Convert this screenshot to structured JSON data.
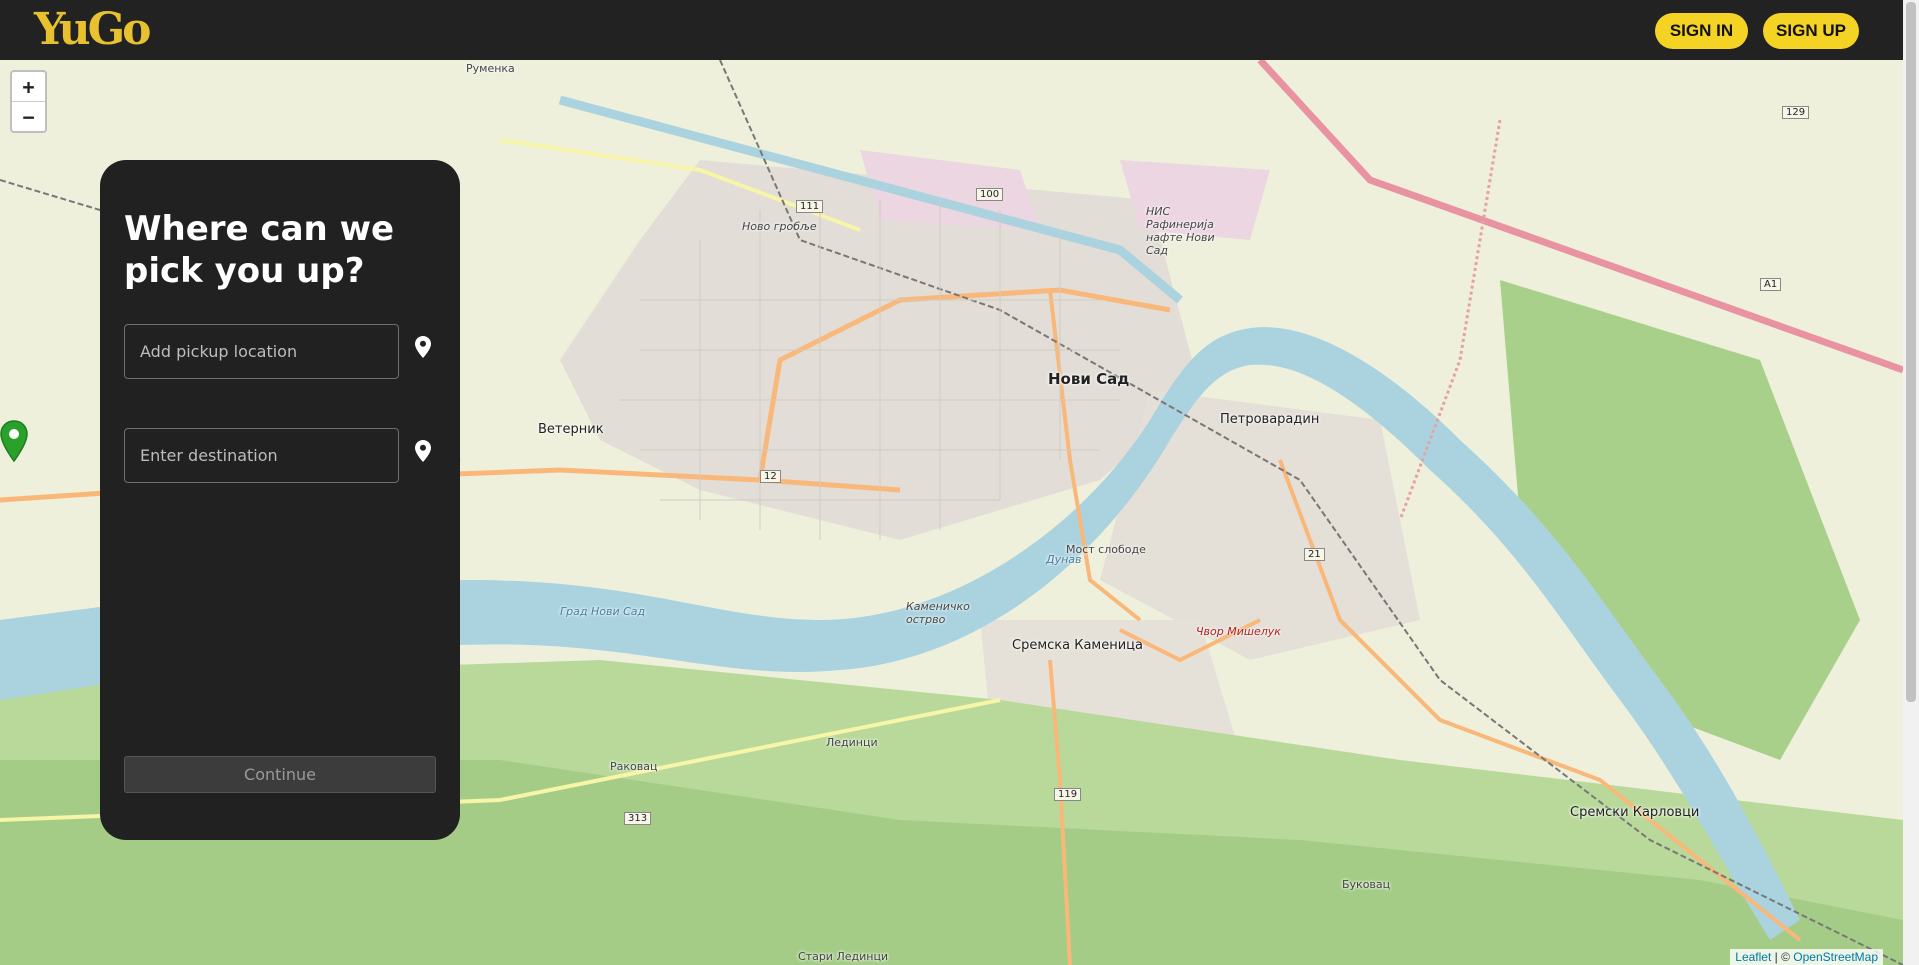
{
  "header": {
    "logo_text": "YuGo",
    "sign_in_label": "SIGN IN",
    "sign_up_label": "SIGN UP",
    "accent_color": "#f5d325"
  },
  "map": {
    "zoom_in_label": "+",
    "zoom_out_label": "−",
    "marker_icon": "map-marker-icon",
    "marker_color": "#2aa12a",
    "attribution": {
      "leaflet": "Leaflet",
      "separator": " | © ",
      "osm": "OpenStreetMap"
    },
    "labels": {
      "novi_sad": "Нови Сад",
      "petrovaradin": "Петроварадин",
      "sremska_kamenica": "Сремска Каменица",
      "sremski_karlovci": "Сремски Карловци",
      "veternik": "Ветерник",
      "rumenka": "Руменка",
      "most_slobode": "Мост слободе",
      "dunav": "Дунав",
      "grad_novi_sad": "Град Нови Сад",
      "ledinci": "Лединци",
      "rakovac": "Раковац",
      "bukovac": "Буковац",
      "refinery": "НИС Рафинерија нафте Нови Сад",
      "novo_groblje": "Ново гробље",
      "kamenicko_ostrvo": "Каменичко острво",
      "cvor_mishelkuk": "Чвор Мишелук",
      "stari_ledinci": "Стари Лединци",
      "road_12": "12",
      "road_100": "100",
      "road_111": "111",
      "road_119": "119",
      "road_313": "313",
      "road_21": "21",
      "road_129": "129",
      "road_a1": "A1"
    }
  },
  "panel": {
    "title": "Where can we pick you up?",
    "pickup_placeholder": "Add pickup location",
    "destination_placeholder": "Enter destination",
    "pin_icon": "location-pin-icon",
    "continue_label": "Continue"
  }
}
